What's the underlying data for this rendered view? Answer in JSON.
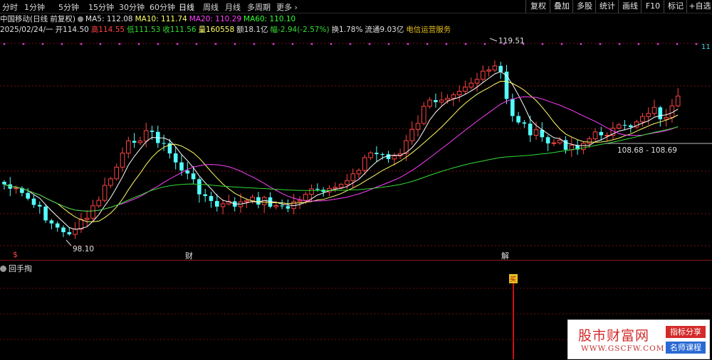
{
  "toolbar": {
    "periods": [
      "分时",
      "1分钟",
      "5分钟",
      "15分钟",
      "30分钟",
      "60分钟",
      "日线",
      "周线",
      "月线",
      "多周期",
      "更多"
    ],
    "active_period": "日线",
    "tools": [
      "复权",
      "叠加",
      "多股",
      "统计",
      "画线",
      "F10",
      "标记",
      "+自选"
    ]
  },
  "info": {
    "stock_name": "中国移动(日线 前复权)",
    "ma5": "MA5: 112.08",
    "ma10": "MA10: 111.74",
    "ma20": "MA20: 110.29",
    "ma60": "MA60: 110.10",
    "date": "2025/02/24/一",
    "open": "开114.50",
    "high": "高114.55",
    "low": "低111.53",
    "close": "收111.56",
    "volume": "量160558",
    "amount": "额18.1亿",
    "change": "幅-2.94(-2.57%)",
    "turnover": "换1.78%",
    "float": "流通9.03亿",
    "industry": "电信运营服务"
  },
  "chart_data": {
    "type": "candlestick",
    "annotations": {
      "max_label": "119.51",
      "min_label": "98.10",
      "range_label": "108.68 - 108.69",
      "right_tag": "11",
      "events": [
        {
          "label": "$",
          "color": "#ff4444"
        },
        {
          "label": "财",
          "color": "#e0e0e0"
        },
        {
          "label": "解",
          "color": "#e0e0e0"
        }
      ]
    },
    "ma_colors": {
      "ma5": "#ffffff",
      "ma10": "#ffff66",
      "ma20": "#ff40ff",
      "ma60": "#33dd33"
    },
    "up_color": "#ff4444",
    "down_color": "#54ffff"
  },
  "subchart": {
    "title": "回手掏",
    "signal_label": "买",
    "signal_color": "#cc1111"
  },
  "watermark": {
    "title": "股市财富网",
    "url": "WWW.GSCFW.COM",
    "tag1": "指标分享",
    "tag2": "名师课程"
  }
}
